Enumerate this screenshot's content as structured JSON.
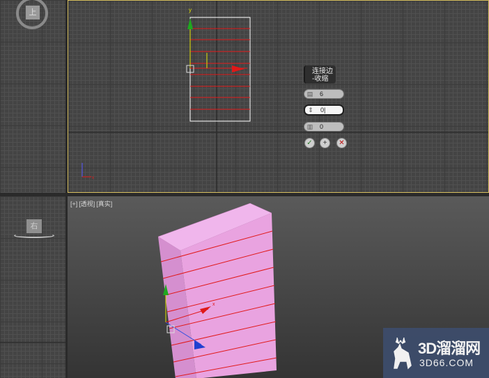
{
  "viewport_top_left": {
    "navcube_face": "上"
  },
  "viewport_bottom_left": {
    "navcube_face": "右"
  },
  "viewport_top": {
    "axis_x": "x",
    "axis_y": "y"
  },
  "caddy": {
    "title_line1": "连接边",
    "title_line2": "-收缩",
    "segments_value": "6",
    "pinch_value": "0|",
    "slide_value": "0",
    "ok_icon": "check-icon",
    "apply_icon": "plus-icon",
    "cancel_icon": "close-icon"
  },
  "viewport_persp": {
    "label_plus": "[+]",
    "label_view": "[透视]",
    "label_shading": "[真实]",
    "axis_x": "x"
  },
  "watermark": {
    "brand": "3D溜溜网",
    "domain": "3D66.COM"
  },
  "colors": {
    "box_fill": "#e9a3e0",
    "edge_red": "#e01818",
    "selection_border": "#d8c060"
  }
}
